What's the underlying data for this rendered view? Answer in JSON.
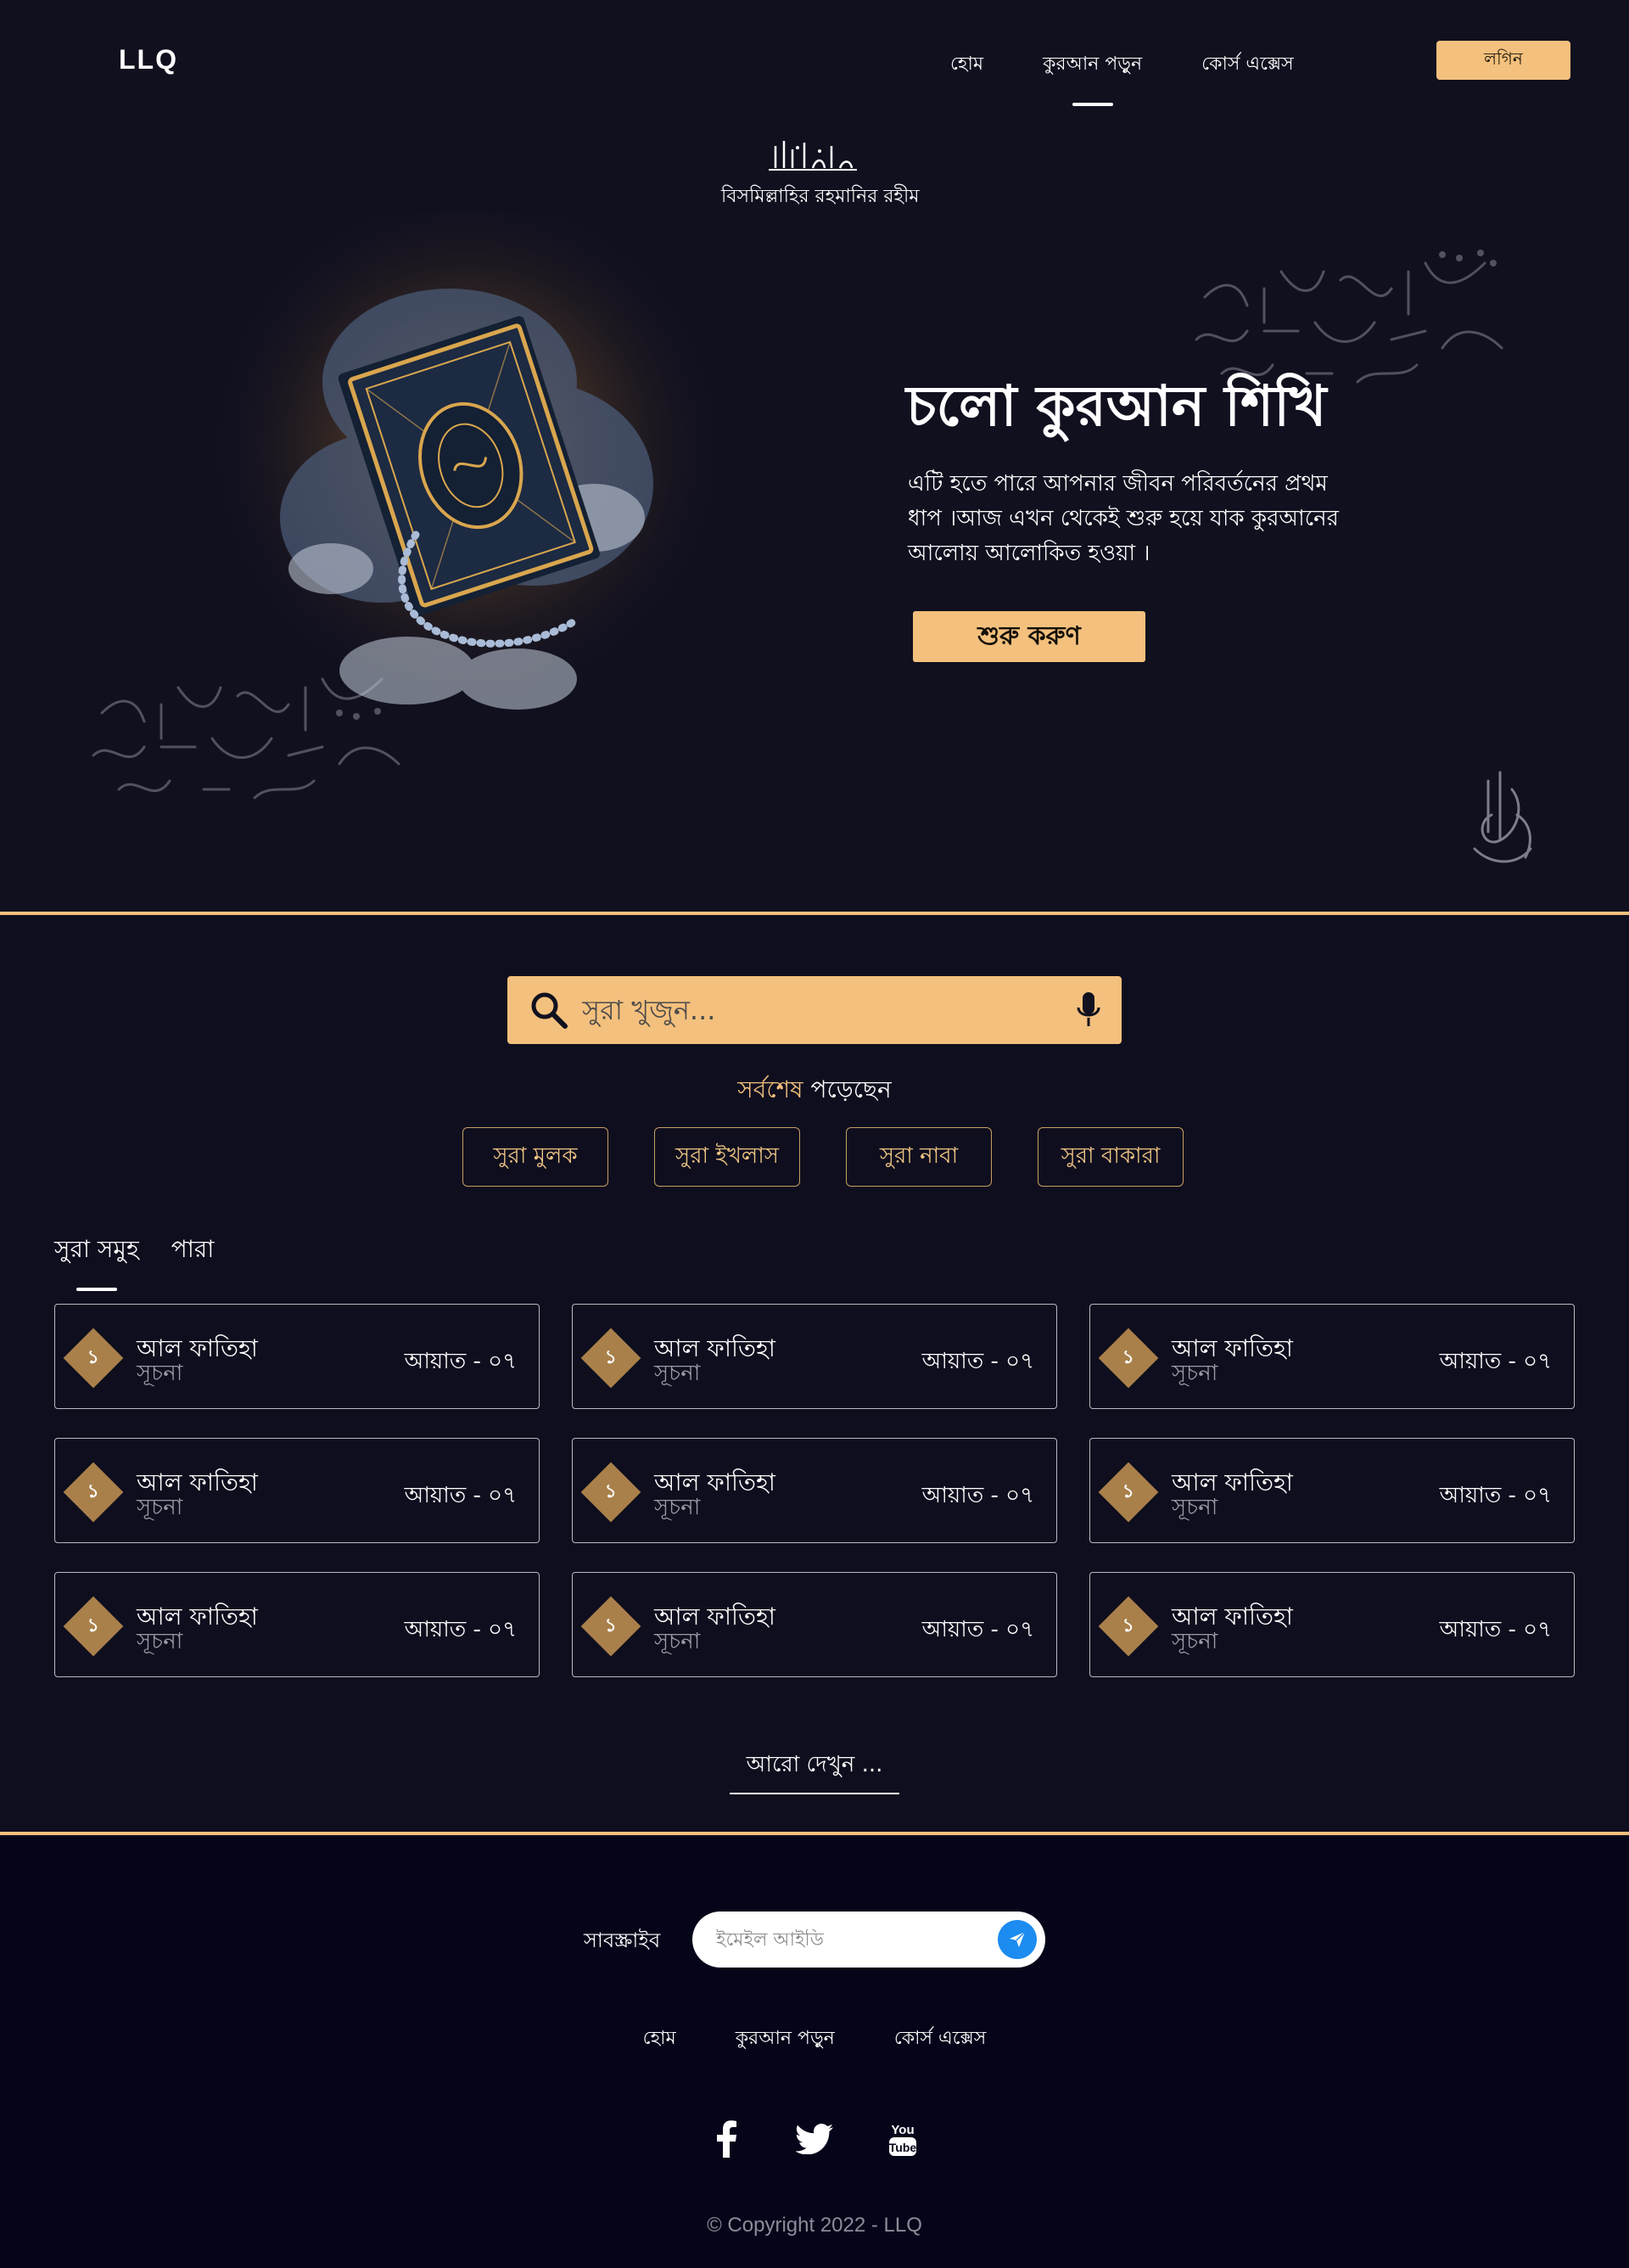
{
  "header": {
    "logo": "LLQ",
    "nav": [
      "হোম",
      "কুরআন পড়ুন",
      "কোর্স এক্সেস"
    ],
    "active_nav": "কুরআন পড়ুন",
    "login_label": "লগিন"
  },
  "hero": {
    "bismillah": "বিসমিল্লাহির রহমানির রহীম",
    "title": "চলো কুরআন শিখি",
    "description": "এটি হতে পারে আপনার জীবন পরিবর্তনের প্রথম ধাপ ।আজ এখন থেকেই শুরু হয়ে যাক কুরআনের আলোয় আলোকিত হওয়া ।",
    "cta_label": "শুরু করুণ"
  },
  "search": {
    "placeholder": "সুরা খুজুন...",
    "value": ""
  },
  "recent": {
    "title_accent": "সর্বশেষ",
    "title_rest": " পড়েছেন",
    "items": [
      "সুরা মুলক",
      "সুরা ইখলাস",
      "সুরা নাবা",
      "সুরা বাকারা"
    ]
  },
  "tabs": {
    "items": [
      "সুরা সমুহ",
      "পারা"
    ],
    "active": "সুরা সমুহ"
  },
  "suras": [
    {
      "number": "১",
      "name": "আল ফাতিহা",
      "meaning": "সূচনা",
      "ayat": "আয়াত - ০৭"
    },
    {
      "number": "১",
      "name": "আল ফাতিহা",
      "meaning": "সূচনা",
      "ayat": "আয়াত - ০৭"
    },
    {
      "number": "১",
      "name": "আল ফাতিহা",
      "meaning": "সূচনা",
      "ayat": "আয়াত - ০৭"
    },
    {
      "number": "১",
      "name": "আল ফাতিহা",
      "meaning": "সূচনা",
      "ayat": "আয়াত - ০৭"
    },
    {
      "number": "১",
      "name": "আল ফাতিহা",
      "meaning": "সূচনা",
      "ayat": "আয়াত - ০৭"
    },
    {
      "number": "১",
      "name": "আল ফাতিহা",
      "meaning": "সূচনা",
      "ayat": "আয়াত - ০৭"
    },
    {
      "number": "১",
      "name": "আল ফাতিহা",
      "meaning": "সূচনা",
      "ayat": "আয়াত - ০৭"
    },
    {
      "number": "১",
      "name": "আল ফাতিহা",
      "meaning": "সূচনা",
      "ayat": "আয়াত - ০৭"
    },
    {
      "number": "১",
      "name": "আল ফাতিহা",
      "meaning": "সূচনা",
      "ayat": "আয়াত - ০৭"
    }
  ],
  "see_more": "আরো দেখুন ...",
  "footer": {
    "subscribe_label": "সাবস্ক্রাইব",
    "email_placeholder": "ইমেইল আইডি",
    "links": [
      "হোম",
      "কুরআন পড়ুন",
      "কোর্স এক্সেস"
    ],
    "social": [
      "facebook-icon",
      "twitter-icon",
      "youtube-icon"
    ],
    "copyright": "© Copyright 2022 - LLQ"
  },
  "colors": {
    "background": "#10101f",
    "accent": "#f4c07d",
    "badge": "#a9804a",
    "footer_bg": "#05051a",
    "send_button": "#1c8cf0"
  }
}
